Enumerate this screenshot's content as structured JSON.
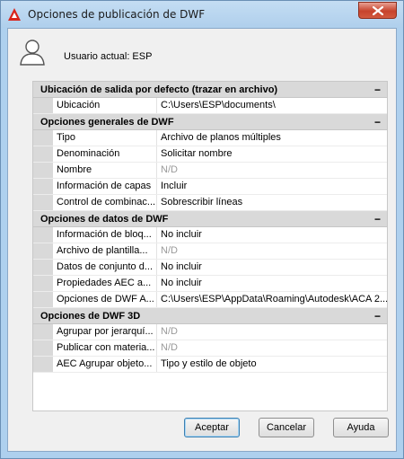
{
  "window": {
    "title": "Opciones de publicación de DWF"
  },
  "current_user": "Usuario actual: ESP",
  "sections": [
    {
      "title": "Ubicación de salida por defecto (trazar en archivo)",
      "collapse": "−",
      "properties": [
        {
          "name": "Ubicación",
          "value": "C:\\Users\\ESP\\documents\\",
          "disabled": false
        }
      ]
    },
    {
      "title": "Opciones generales de DWF",
      "collapse": "−",
      "properties": [
        {
          "name": "Tipo",
          "value": "Archivo de planos múltiples",
          "disabled": false
        },
        {
          "name": "Denominación",
          "value": "Solicitar nombre",
          "disabled": false
        },
        {
          "name": "Nombre",
          "value": "N/D",
          "disabled": true
        },
        {
          "name": "Información de capas",
          "value": "Incluir",
          "disabled": false
        },
        {
          "name": "Control de combinac...",
          "value": "Sobrescribir líneas",
          "disabled": false
        }
      ]
    },
    {
      "title": "Opciones de datos de DWF",
      "collapse": "−",
      "properties": [
        {
          "name": "Información de bloq...",
          "value": "No incluir",
          "disabled": false
        },
        {
          "name": "Archivo de plantilla...",
          "value": "N/D",
          "disabled": true
        },
        {
          "name": "Datos de conjunto d...",
          "value": "No incluir",
          "disabled": false
        },
        {
          "name": "Propiedades AEC a...",
          "value": "No incluir",
          "disabled": false
        },
        {
          "name": "Opciones de DWF A...",
          "value": "C:\\Users\\ESP\\AppData\\Roaming\\Autodesk\\ACA 2...",
          "disabled": false
        }
      ]
    },
    {
      "title": "Opciones de DWF 3D",
      "collapse": "−",
      "properties": [
        {
          "name": "Agrupar por jerarquí...",
          "value": "N/D",
          "disabled": true
        },
        {
          "name": "Publicar con materia...",
          "value": "N/D",
          "disabled": true
        },
        {
          "name": "AEC Agrupar objeto...",
          "value": "Tipo y estilo de objeto",
          "disabled": false
        }
      ]
    }
  ],
  "buttons": {
    "accept": "Aceptar",
    "cancel": "Cancelar",
    "help": "Ayuda"
  },
  "colors": {
    "section_header": "#d9d9d9",
    "frame": "#aed0ee",
    "close_button": "#c7432c"
  }
}
